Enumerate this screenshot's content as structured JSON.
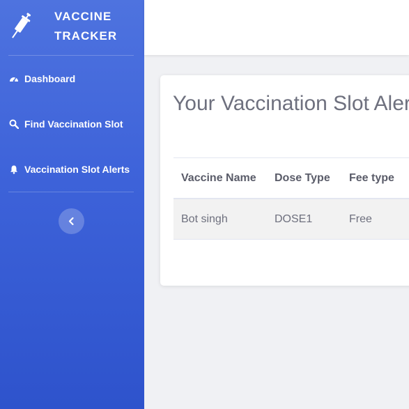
{
  "brand": {
    "line1": "VACCINE",
    "line2": "TRACKER",
    "icon": "syringe-icon"
  },
  "sidebar": {
    "items": [
      {
        "label": "Dashboard",
        "icon": "tachometer-icon"
      },
      {
        "label": "Find Vaccination Slot",
        "icon": "search-icon"
      },
      {
        "label": "Vaccination Slot Alerts",
        "icon": "bell-icon"
      }
    ],
    "toggle_icon": "chevron-left-icon"
  },
  "main": {
    "title": "Your Vaccination Slot Alerts",
    "table": {
      "headers": [
        "Vaccine Name",
        "Dose Type",
        "Fee type"
      ],
      "rows": [
        [
          "Bot singh",
          "DOSE1",
          "Free"
        ]
      ]
    }
  },
  "colors": {
    "sidebar_top": "#4e73df",
    "sidebar_bottom": "#2e53cc",
    "text": "#6e707e"
  }
}
